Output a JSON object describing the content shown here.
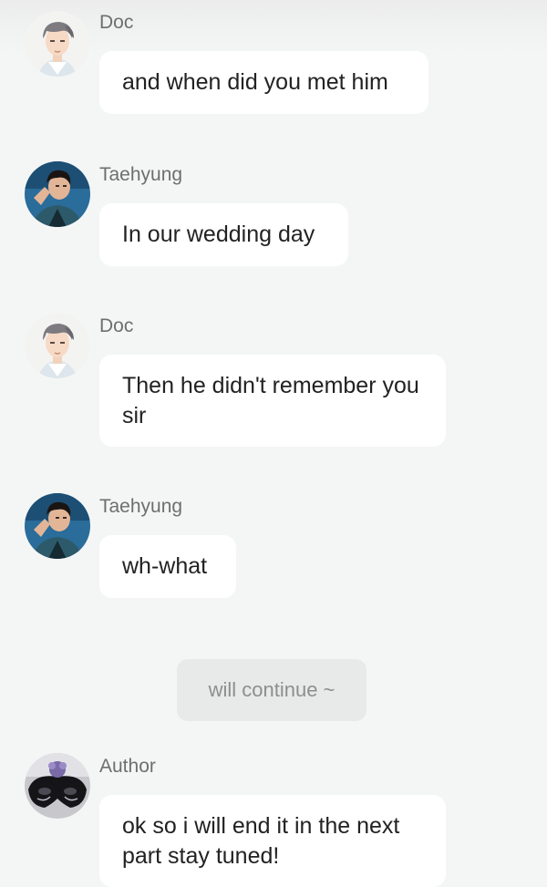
{
  "messages": [
    {
      "sender": "Doc",
      "text": "and when did you met him",
      "avatar": "doc-avatar-icon"
    },
    {
      "sender": "Taehyung",
      "text": "In our wedding day",
      "avatar": "taehyung-avatar-icon"
    },
    {
      "sender": "Doc",
      "text": "Then he didn't remember you sir",
      "avatar": "doc-avatar-icon"
    },
    {
      "sender": "Taehyung",
      "text": "wh-what",
      "avatar": "taehyung-avatar-icon"
    }
  ],
  "system_note": "will continue ~",
  "author_message": {
    "sender": "Author",
    "text": "ok so i will end it in the next part stay tuned!",
    "avatar": "author-mask-avatar-icon"
  },
  "colors": {
    "background": "#f4f6f6",
    "bubble": "#ffffff",
    "sender_text": "#6e6e6e",
    "message_text": "#222222",
    "system_pill": "#e8eaea"
  }
}
